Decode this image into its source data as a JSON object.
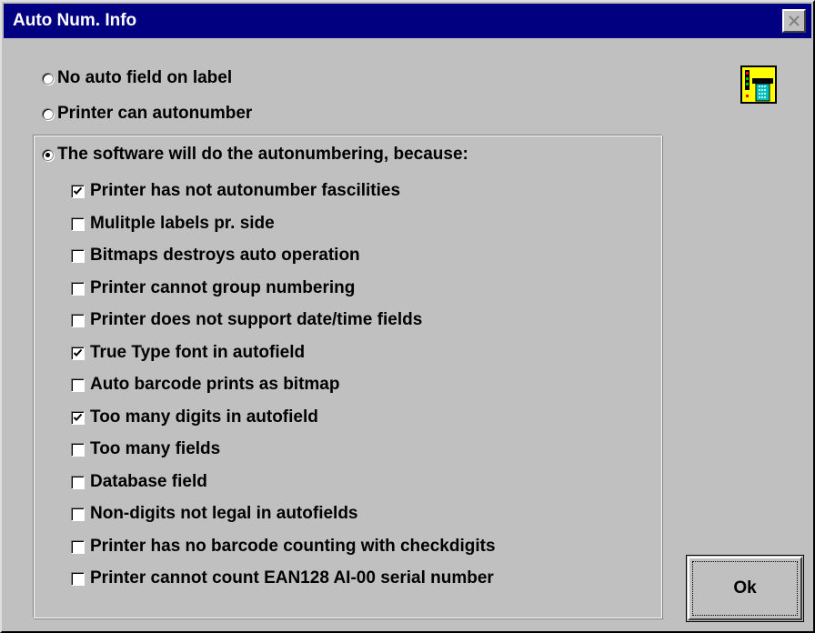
{
  "window": {
    "title": "Auto Num. Info",
    "close_icon": "close-icon"
  },
  "radios": [
    {
      "label": "No auto field on label",
      "selected": false
    },
    {
      "label": "Printer can autonumber",
      "selected": false
    },
    {
      "label": "The software will do the autonumbering, because:",
      "selected": true
    }
  ],
  "reasons": [
    {
      "label": "Printer has not autonumber fascilities",
      "checked": true
    },
    {
      "label": "Mulitple labels pr. side",
      "checked": false
    },
    {
      "label": "Bitmaps destroys auto operation",
      "checked": false
    },
    {
      "label": "Printer cannot group numbering",
      "checked": false
    },
    {
      "label": "Printer does not support date/time fields",
      "checked": false
    },
    {
      "label": "True Type font in autofield",
      "checked": true
    },
    {
      "label": "Auto barcode prints as bitmap",
      "checked": false
    },
    {
      "label": "Too many digits in autofield",
      "checked": true
    },
    {
      "label": "Too many fields",
      "checked": false
    },
    {
      "label": "Database field",
      "checked": false
    },
    {
      "label": "Non-digits not legal in autofields",
      "checked": false
    },
    {
      "label": "Printer has no barcode counting with checkdigits",
      "checked": false
    },
    {
      "label": "Printer cannot count EAN128 AI-00 serial number",
      "checked": false
    }
  ],
  "ok_button": {
    "label": "Ok"
  },
  "colors": {
    "titlebar": "#000080",
    "face": "#c0c0c0",
    "icon_body": "#ffff00"
  }
}
